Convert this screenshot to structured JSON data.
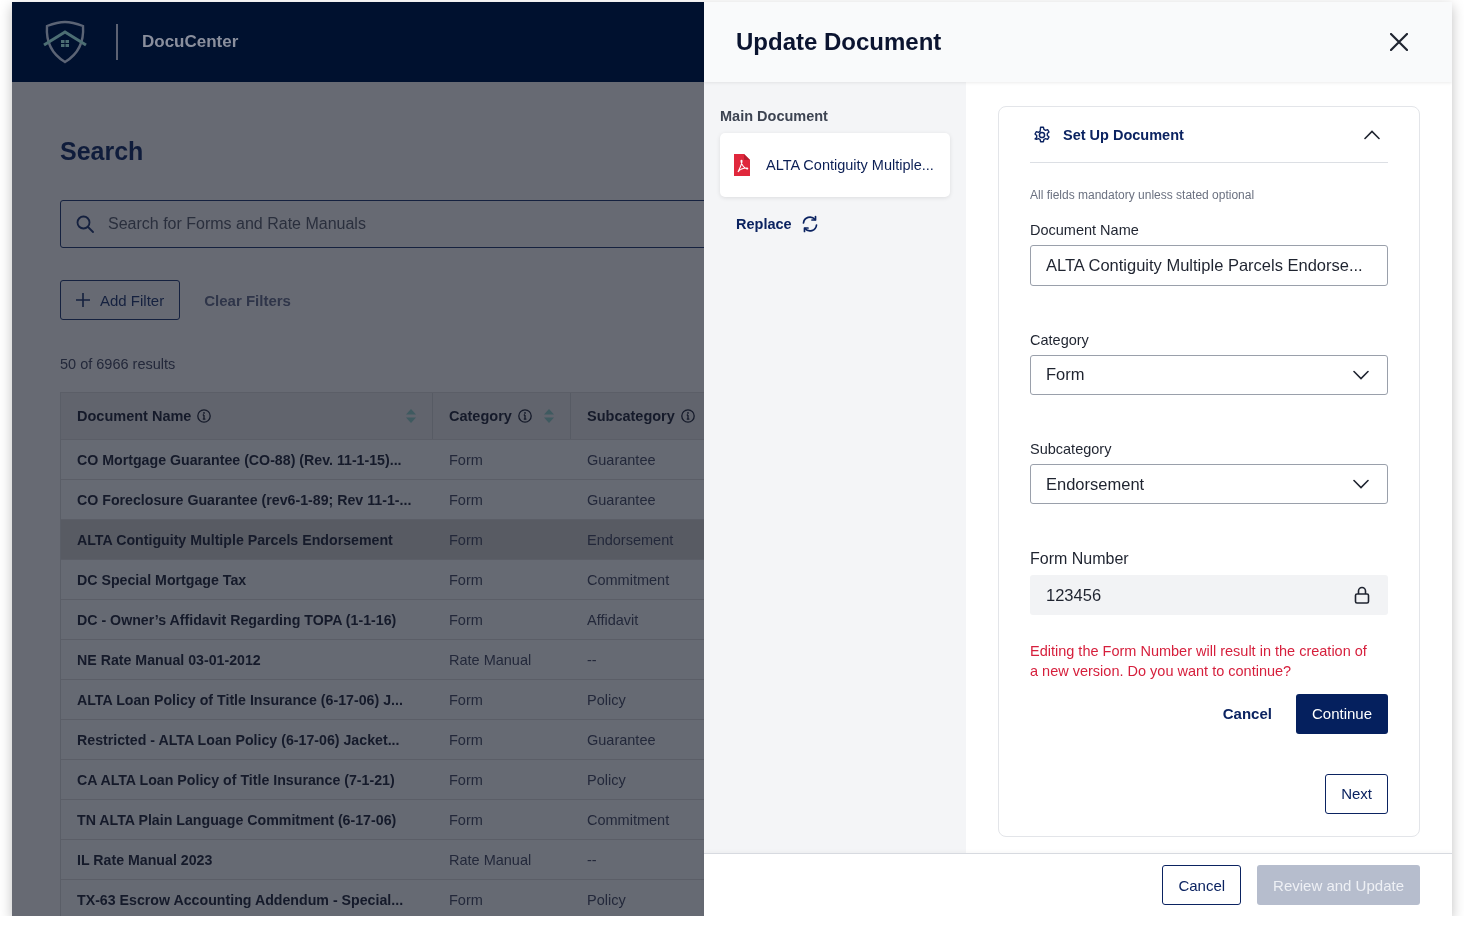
{
  "app": {
    "name": "DocuCenter"
  },
  "search_page": {
    "title": "Search",
    "search": {
      "placeholder": "Search for Forms and Rate Manuals"
    },
    "filter_buttons": [
      {
        "label": "Add Filter",
        "kind": "add"
      },
      {
        "label": "Clear Filters",
        "kind": "text"
      }
    ],
    "result_count": "50 of 6966 results",
    "table": {
      "columns": [
        {
          "label": "Document Name",
          "sortable": true
        },
        {
          "label": "Category",
          "sortable": true
        },
        {
          "label": "Subcategory",
          "sortable": false
        }
      ],
      "rows": [
        {
          "cells": [
            "CO Mortgage Guarantee (CO-88) (Rev. 11-1-15)...",
            "Form",
            "Guarantee"
          ],
          "selected": false
        },
        {
          "cells": [
            "CO Foreclosure Guarantee (rev6-1-89; Rev 11-1-...",
            "Form",
            "Guarantee"
          ],
          "selected": false
        },
        {
          "cells": [
            "ALTA Contiguity Multiple Parcels Endorsement",
            "Form",
            "Endorsement"
          ],
          "selected": true
        },
        {
          "cells": [
            "DC Special Mortgage Tax",
            "Form",
            "Commitment"
          ],
          "selected": false
        },
        {
          "cells": [
            "DC - Owner’s Affidavit Regarding TOPA (1-1-16)",
            "Form",
            "Affidavit"
          ],
          "selected": false
        },
        {
          "cells": [
            "NE Rate Manual 03-01-2012",
            "Rate Manual",
            "--"
          ],
          "selected": false
        },
        {
          "cells": [
            "ALTA Loan Policy of Title Insurance (6-17-06) J...",
            "Form",
            "Policy"
          ],
          "selected": false
        },
        {
          "cells": [
            "Restricted - ALTA Loan Policy (6-17-06) Jacket...",
            "Form",
            "Guarantee"
          ],
          "selected": false
        },
        {
          "cells": [
            "CA ALTA Loan Policy of Title Insurance (7-1-21)",
            "Form",
            "Policy"
          ],
          "selected": false
        },
        {
          "cells": [
            "TN ALTA Plain Language Commitment (6-17-06)",
            "Form",
            "Commitment"
          ],
          "selected": false
        },
        {
          "cells": [
            "IL Rate Manual 2023",
            "Rate Manual",
            "--"
          ],
          "selected": false
        },
        {
          "cells": [
            "TX-63 Escrow Accounting Addendum - Special...",
            "Form",
            "Policy"
          ],
          "selected": false
        }
      ]
    }
  },
  "drawer": {
    "title": "Update Document",
    "main_document": {
      "heading": "Main Document",
      "file_name": "ALTA Contiguity Multiple...",
      "replace": "Replace"
    },
    "section": {
      "title": "Set Up Document",
      "expanded": true,
      "note": "All fields mandatory unless stated optional",
      "fields": [
        {
          "kind": "text",
          "label": "Document Name",
          "value": "ALTA Contiguity Multiple Parcels Endorse..."
        },
        {
          "kind": "select",
          "label": "Category",
          "value": "Form"
        },
        {
          "kind": "select",
          "label": "Subcategory",
          "value": "Endorsement"
        },
        {
          "kind": "locked",
          "label": "Form Number",
          "value": "123456"
        }
      ],
      "warning": "Editing the Form Number will result in the creation of a new version. Do you want to continue?",
      "confirm_buttons": [
        {
          "label": "Cancel",
          "kind": "text"
        },
        {
          "label": "Continue",
          "kind": "primary"
        }
      ],
      "next": "Next"
    },
    "footer_buttons": [
      {
        "label": "Cancel",
        "kind": "outlined",
        "disabled": false
      },
      {
        "label": "Review and Update",
        "kind": "primary",
        "disabled": true
      }
    ]
  }
}
